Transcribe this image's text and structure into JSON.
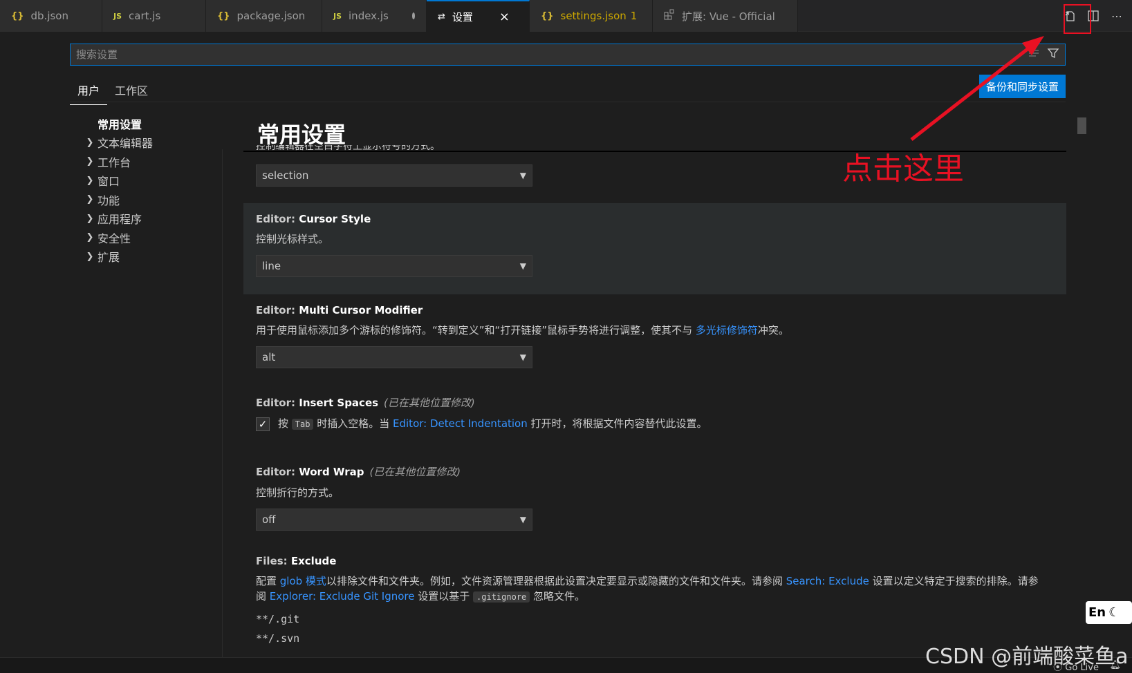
{
  "tabs": [
    {
      "label": "db.json",
      "icon": "{}",
      "icon_kind": "json"
    },
    {
      "label": "cart.js",
      "icon": "JS",
      "icon_kind": "js"
    },
    {
      "label": "package.json",
      "icon": "{}",
      "icon_kind": "json"
    },
    {
      "label": "index.js",
      "icon": "JS",
      "icon_kind": "js",
      "unsaved": true
    },
    {
      "label": "设置",
      "icon": "⇄",
      "active": true
    },
    {
      "label": "settings.json",
      "badge": "1",
      "icon": "{}",
      "icon_kind": "json"
    },
    {
      "label": "扩展: Vue - Official",
      "icon": "ext"
    }
  ],
  "search": {
    "placeholder": "搜索设置"
  },
  "scope_tabs": {
    "user": "用户",
    "workspace": "工作区"
  },
  "backup_button": "备份和同步设置",
  "toc": {
    "header": "常用设置",
    "items": [
      "文本编辑器",
      "工作台",
      "窗口",
      "功能",
      "应用程序",
      "安全性",
      "扩展"
    ]
  },
  "content": {
    "category_title": "常用设置",
    "cut_text": "控制编辑器在空白字符上显示符号的方式。",
    "render_whitespace": {
      "value": "selection"
    },
    "cursor_style": {
      "category": "Editor: ",
      "name": "Cursor Style",
      "description": "控制光标样式。",
      "value": "line"
    },
    "multi_cursor": {
      "category": "Editor: ",
      "name": "Multi Cursor Modifier",
      "desc_before": "用于使用鼠标添加多个游标的修饰符。“转到定义”和“打开链接”鼠标手势将进行调整，使其不与 ",
      "desc_link": "多光标修饰符",
      "desc_after": "冲突。",
      "value": "alt"
    },
    "insert_spaces": {
      "category": "Editor: ",
      "name": "Insert Spaces",
      "modified": "(已在其他位置修改)",
      "desc_before": "按 ",
      "kbd": "Tab",
      "desc_mid": " 时插入空格。当 ",
      "desc_link": "Editor: Detect Indentation",
      "desc_after": " 打开时，将根据文件内容替代此设置。",
      "checked": true
    },
    "word_wrap": {
      "category": "Editor: ",
      "name": "Word Wrap",
      "modified": "(已在其他位置修改)",
      "description": "控制折行的方式。",
      "value": "off"
    },
    "files_exclude": {
      "category": "Files: ",
      "name": "Exclude",
      "d1": "配置 ",
      "l1": "glob 模式",
      "d2": "以排除文件和文件夹。例如，文件资源管理器根据此设置决定要显示或隐藏的文件和文件夹。请参阅 ",
      "l2": "Search: Exclude",
      "d3": " 设置以定义特定于搜索的排除。请参阅 ",
      "l3": "Explorer: Exclude Git Ignore",
      "d4": " 设置以基于 ",
      "code": ".gitignore",
      "d5": " 忽略文件。",
      "patterns": [
        "**/.git",
        "**/.svn"
      ]
    }
  },
  "annotation": {
    "text": "点击这里",
    "color": "#e81123"
  },
  "status": {
    "golive": "Go Live"
  },
  "ime": {
    "label": "En"
  },
  "watermark": "CSDN @前端酸菜鱼a",
  "colors": {
    "accent": "#0078d4",
    "link": "#3794ff",
    "background": "#1e1e1e"
  }
}
